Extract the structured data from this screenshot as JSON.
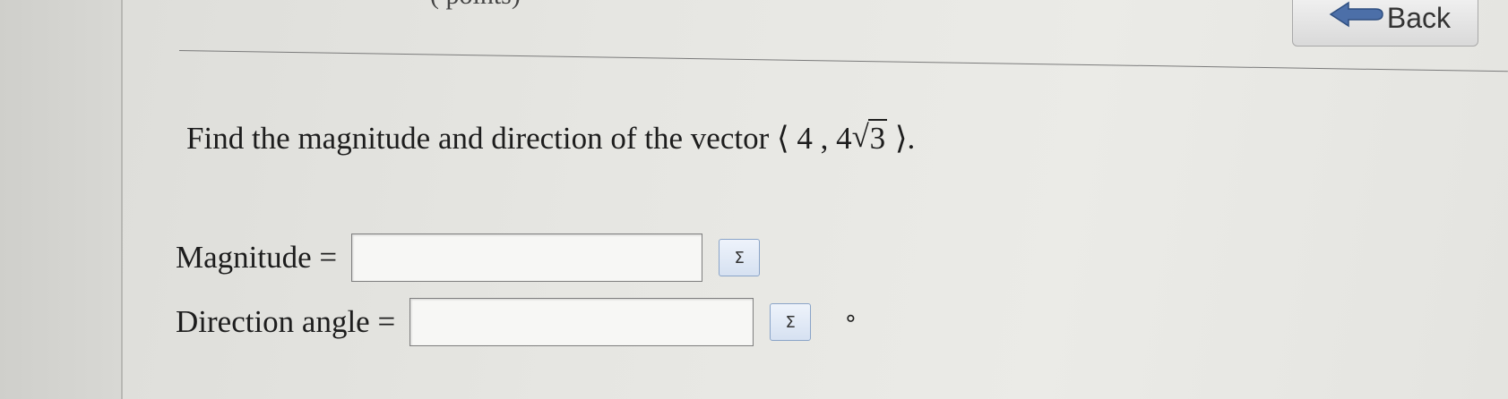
{
  "header": {
    "partial_text": "( points)",
    "back_label": "Back"
  },
  "question": {
    "prefix": "Find the magnitude and direction of the vector",
    "open_bracket": "⟨",
    "x_component": "4",
    "comma": ",",
    "y_coefficient": "4",
    "sqrt_radicand": "3",
    "close_bracket": "⟩",
    "end_punct": "."
  },
  "fields": {
    "magnitude_label": "Magnitude =",
    "magnitude_value": "",
    "direction_label": "Direction angle =",
    "direction_value": "",
    "sigma_symbol": "Σ",
    "degree_symbol": "∘"
  }
}
